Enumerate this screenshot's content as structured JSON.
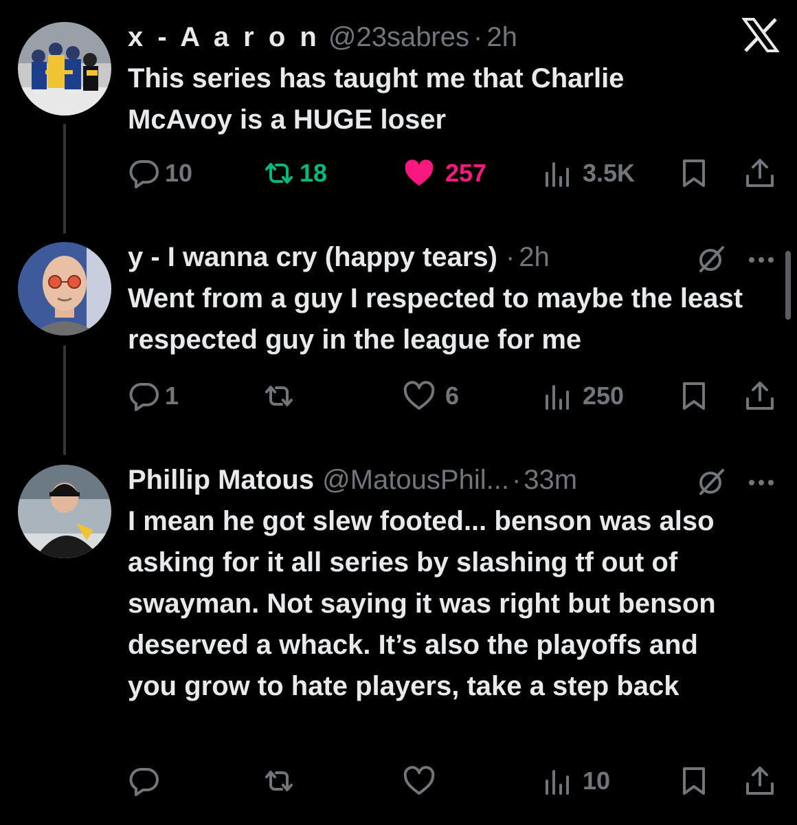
{
  "tweets": [
    {
      "name": "x - A a r o n",
      "handle": "@23sabres",
      "separator": "·",
      "time": "2h",
      "text": "This series has taught me that Charlie McAvoy is a HUGE loser",
      "replies": "10",
      "reposts": "18",
      "likes": "257",
      "views": "3.5K",
      "liked": true,
      "reposted": true,
      "avatar_icon": "hockey-celebration-photo"
    },
    {
      "name": "y - I wanna cry (happy tears)",
      "handle": "",
      "separator": "·",
      "time": "2h",
      "text": "Went from a guy I respected to maybe the least respected guy in the league for me",
      "replies": "1",
      "reposts": "",
      "likes": "6",
      "views": "250",
      "liked": false,
      "reposted": false,
      "avatar_icon": "man-with-glasses-photo"
    },
    {
      "name": "Phillip Matous",
      "handle": "@MatousPhil...",
      "separator": "·",
      "time": "33m",
      "text": "I mean he got slew footed... benson was also asking for it all series by slashing tf out of swayman. Not saying it was right but benson deserved a whack. It’s also the playoffs and you grow to hate players, take a step back",
      "replies": "",
      "reposts": "",
      "likes": "",
      "views": "10",
      "liked": false,
      "reposted": false,
      "avatar_icon": "hockey-player-photo"
    }
  ],
  "colors": {
    "background": "#000000",
    "text": "#e7e9ea",
    "muted": "#71767b",
    "repost_active": "#00ba7c",
    "like_active": "#f91880"
  },
  "icons": {
    "brand": "x-logo-icon",
    "reply": "reply-bubble-icon",
    "repost": "repost-icon",
    "like": "heart-icon",
    "views": "views-bars-icon",
    "bookmark": "bookmark-icon",
    "share": "share-icon",
    "grok": "grok-icon",
    "more": "more-dots-icon"
  }
}
